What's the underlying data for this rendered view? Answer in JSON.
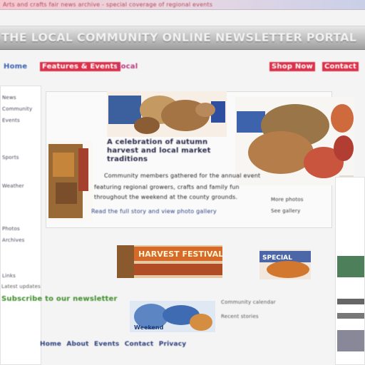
{
  "browser": {
    "tab_text": "Arts and crafts fair news archive - special coverage of regional events"
  },
  "site": {
    "title": "THE LOCAL COMMUNITY ONLINE NEWSLETTER PORTAL"
  },
  "nav": {
    "items": [
      "Home",
      "Features & Events",
      "Local",
      "Shop Now",
      "Contact"
    ]
  },
  "sidebar": {
    "links": [
      "News",
      "Community",
      "Events",
      "Sports",
      "Weather",
      "Photos",
      "Archives",
      "Links"
    ]
  },
  "feature": {
    "headline": "A celebration of autumn harvest and local market traditions",
    "lines": [
      "Community members gathered for the annual event",
      "featuring regional growers, crafts and family fun",
      "throughout the weekend at the county grounds.",
      "Read the full story and view photo gallery"
    ],
    "side_captions": [
      "More photos",
      "See gallery"
    ]
  },
  "promos": {
    "promo1_text": "HARVEST FESTIVAL",
    "promo2_text": "SPECIAL",
    "promo3_text": "Weekend"
  },
  "lower": {
    "green_link": "Subscribe to our newsletter",
    "text_lines": [
      "Latest updates",
      "Community calendar",
      "Recent stories"
    ]
  },
  "footer": {
    "links": [
      "Home",
      "About",
      "Events",
      "Contact",
      "Privacy"
    ]
  },
  "colors": {
    "nav_red": "#d9324a",
    "nav_magenta": "#b73a7d",
    "nav_blue": "#3a5fb0",
    "green": "#3f8c2c"
  }
}
